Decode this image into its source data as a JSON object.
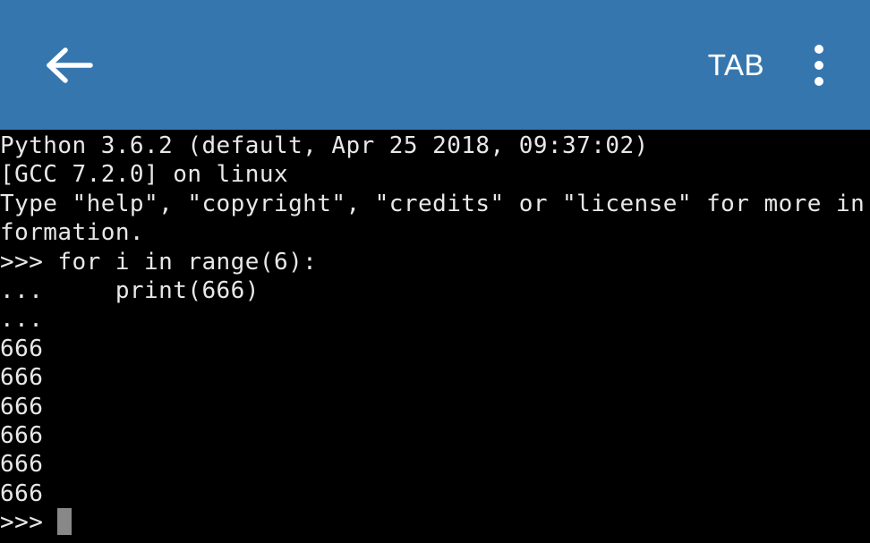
{
  "appbar": {
    "back_icon": "arrow-left-icon",
    "tab_label": "TAB",
    "overflow_icon": "more-vertical-icon",
    "background_color": "#3676af",
    "foreground_color": "#ffffff"
  },
  "terminal": {
    "background_color": "#000000",
    "text_color": "#e8e8e8",
    "cursor_color": "#888888",
    "columns": 60,
    "lines": [
      "Python 3.6.2 (default, Apr 25 2018, 09:37:02)",
      "[GCC 7.2.0] on linux",
      "Type \"help\", \"copyright\", \"credits\" or \"license\" for more in",
      "formation.",
      ">>> for i in range(6):",
      "...     print(666)",
      "... ",
      "666",
      "666",
      "666",
      "666",
      "666",
      "666"
    ],
    "prompt": ">>> ",
    "cursor_visible": true
  }
}
